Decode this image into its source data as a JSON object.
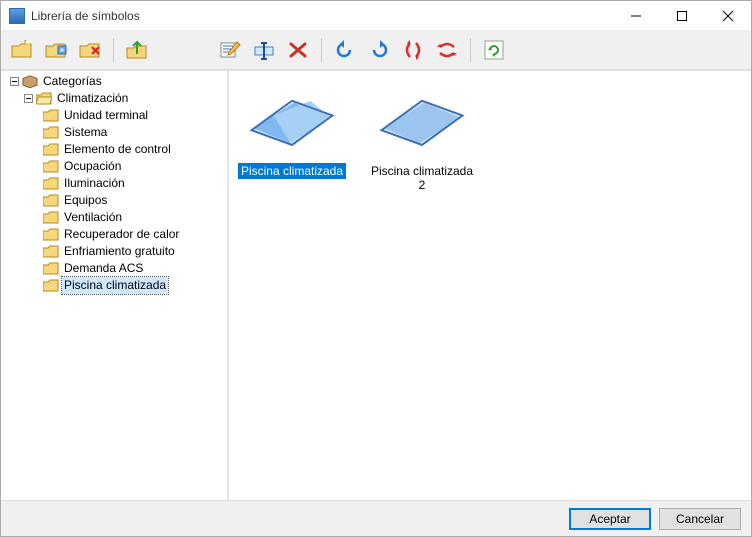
{
  "window": {
    "title": "Librería de símbolos"
  },
  "tree": {
    "root": "Categorías",
    "group": "Climatización",
    "items": [
      "Unidad terminal",
      "Sistema",
      "Elemento de control",
      "Ocupación",
      "Iluminación",
      "Equipos",
      "Ventilación",
      "Recuperador de calor",
      "Enfriamiento gratuito",
      "Demanda ACS",
      "Piscina climatizada"
    ],
    "selected_index": 10
  },
  "symbols": [
    {
      "label": "Piscina climatizada",
      "selected": true
    },
    {
      "label": "Piscina climatizada 2",
      "selected": false
    }
  ],
  "footer": {
    "accept": "Aceptar",
    "cancel": "Cancelar"
  }
}
